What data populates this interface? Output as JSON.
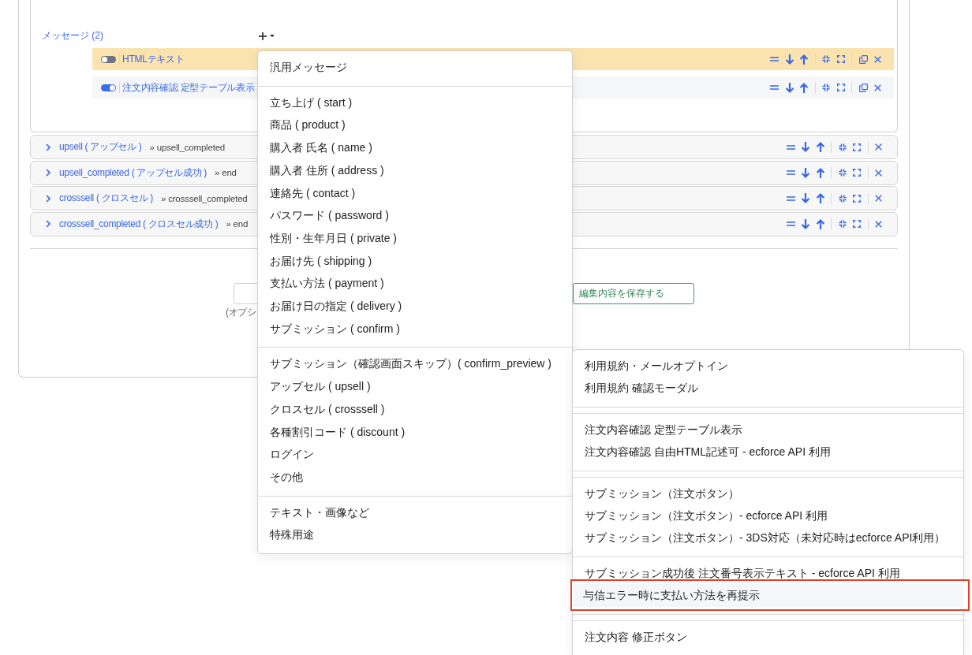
{
  "messages": {
    "label": "メッセージ (2)",
    "items": [
      {
        "title": "HTMLテキスト",
        "enabled": false,
        "selected": true
      },
      {
        "title": "注文内容確認 定型テーブル表示",
        "enabled": true,
        "selected": false
      }
    ]
  },
  "steps": [
    {
      "title": "upsell ( アップセル )",
      "next": "» upsell_completed",
      "expanded": false
    },
    {
      "title": "upsell_completed ( アップセル成功 )",
      "next": "» end",
      "expanded": false
    },
    {
      "title": "crosssell ( クロスセル )",
      "next": "» crosssell_completed",
      "expanded": false
    },
    {
      "title": "crosssell_completed ( クロスセル成功 )",
      "next": "» end",
      "expanded": false
    }
  ],
  "footer": {
    "hint": "(オプシ",
    "save_button": "編集内容を保存する"
  },
  "add_menu": {
    "groups": [
      {
        "items": [
          "汎用メッセージ"
        ]
      },
      {
        "items": [
          "立ち上げ ( start )",
          "商品 ( product )",
          "購入者 氏名 ( name )",
          "購入者 住所 ( address )",
          "連絡先 ( contact )",
          "パスワード ( password )",
          "性別・生年月日 ( private )",
          "お届け先 ( shipping )",
          "支払い方法 ( payment )",
          "お届け日の指定 ( delivery )",
          "サブミッション ( confirm )"
        ]
      },
      {
        "items": [
          "サブミッション（確認画面スキップ）( confirm_preview )",
          "アップセル ( upsell )",
          "クロスセル ( crosssell )",
          "各種割引コード ( discount )",
          "ログイン",
          "その他"
        ]
      },
      {
        "items": [
          "テキスト・画像など",
          "特殊用途"
        ]
      }
    ]
  },
  "submenu": {
    "sections": [
      {
        "groups": [
          {
            "items": [
              {
                "label": "利用規約・メールオプトイン",
                "highlighted": false
              },
              {
                "label": "利用規約 確認モーダル",
                "highlighted": false
              }
            ]
          }
        ]
      },
      {
        "groups": [
          {
            "items": [
              {
                "label": "注文内容確認 定型テーブル表示",
                "highlighted": false
              },
              {
                "label": "注文内容確認 自由HTML記述可 - ecforce API 利用",
                "highlighted": false
              }
            ]
          }
        ]
      },
      {
        "groups": [
          {
            "items": [
              {
                "label": "サブミッション（注文ボタン）",
                "highlighted": false
              },
              {
                "label": "サブミッション（注文ボタン）- ecforce API 利用",
                "highlighted": false
              },
              {
                "label": "サブミッション（注文ボタン）- 3DS対応（未対応時はecforce API利用）",
                "highlighted": false
              }
            ]
          },
          {
            "items": [
              {
                "label": "サブミッション成功後 注文番号表示テキスト - ecforce API 利用",
                "highlighted": false
              },
              {
                "label": "与信エラー時に支払い方法を再提示",
                "highlighted": true
              }
            ]
          }
        ]
      },
      {
        "groups": [
          {
            "items": [
              {
                "label": "注文内容 修正ボタン",
                "highlighted": false
              }
            ]
          }
        ]
      }
    ]
  }
}
